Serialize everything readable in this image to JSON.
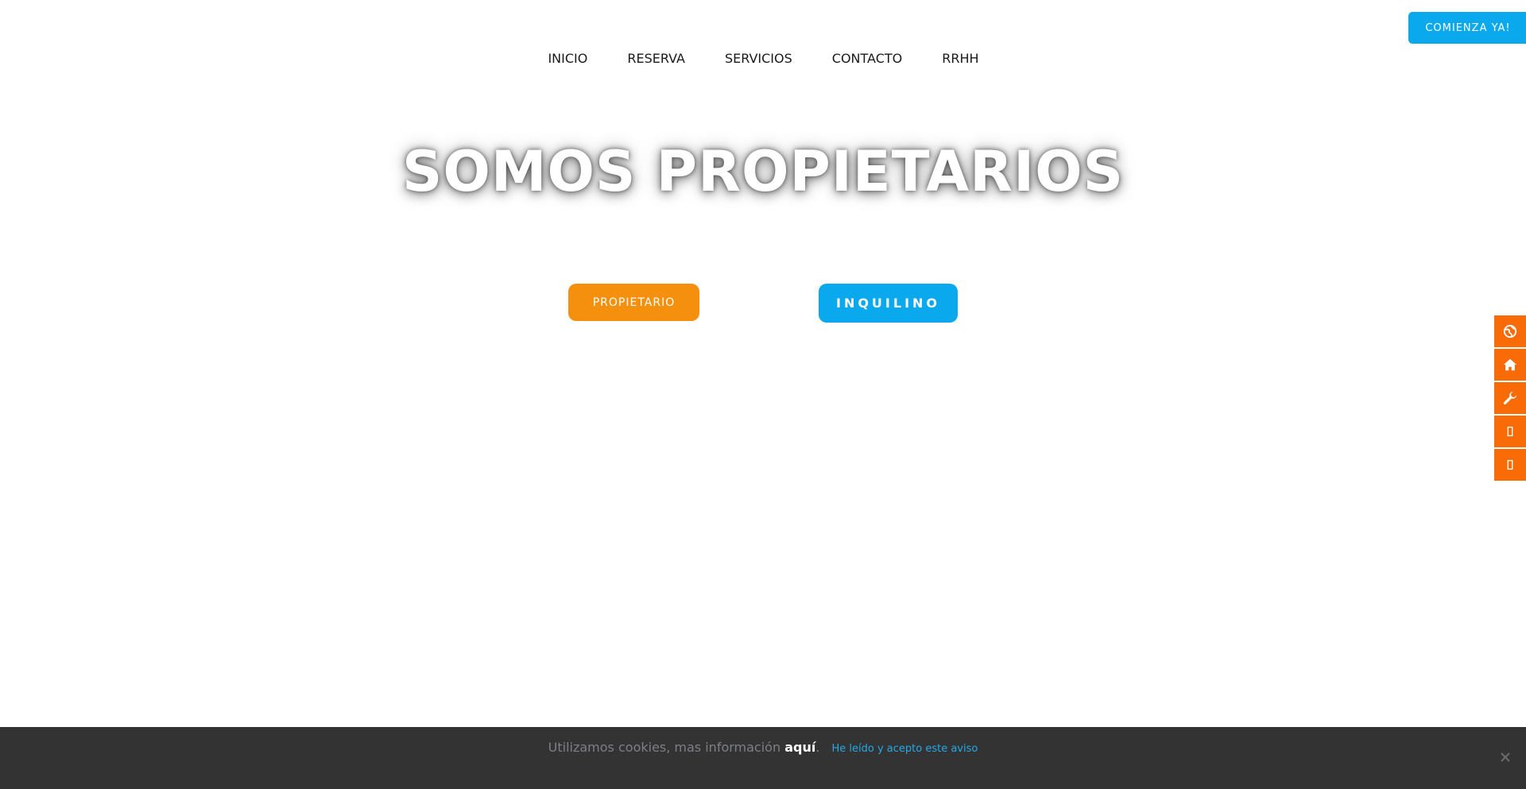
{
  "header": {
    "cta_label": "COMIENZA YA!"
  },
  "nav": {
    "items": [
      {
        "label": "INICIO"
      },
      {
        "label": "RESERVA"
      },
      {
        "label": "SERVICIOS"
      },
      {
        "label": "CONTACTO"
      },
      {
        "label": "RRHH"
      }
    ]
  },
  "hero": {
    "title": "SOMOS PROPIETARIOS",
    "owner_button": "PROPIETARIO",
    "tenant_button": "INQUILINO"
  },
  "side_bar": {
    "icons": [
      "globe-icon",
      "home-icon",
      "wrench-icon",
      "missing-glyph-icon",
      "missing-glyph-icon"
    ],
    "color": "#f86b07"
  },
  "cookie_banner": {
    "message": "Utilizamos cookies, mas información",
    "link": "aquí",
    "punct": ".",
    "accept": "He leído y acepto este aviso"
  },
  "colors": {
    "accent_blue": "#0aa8ec",
    "accent_orange": "#f5900f",
    "side_orange": "#f86b07",
    "cookie_bg": "#333333"
  }
}
